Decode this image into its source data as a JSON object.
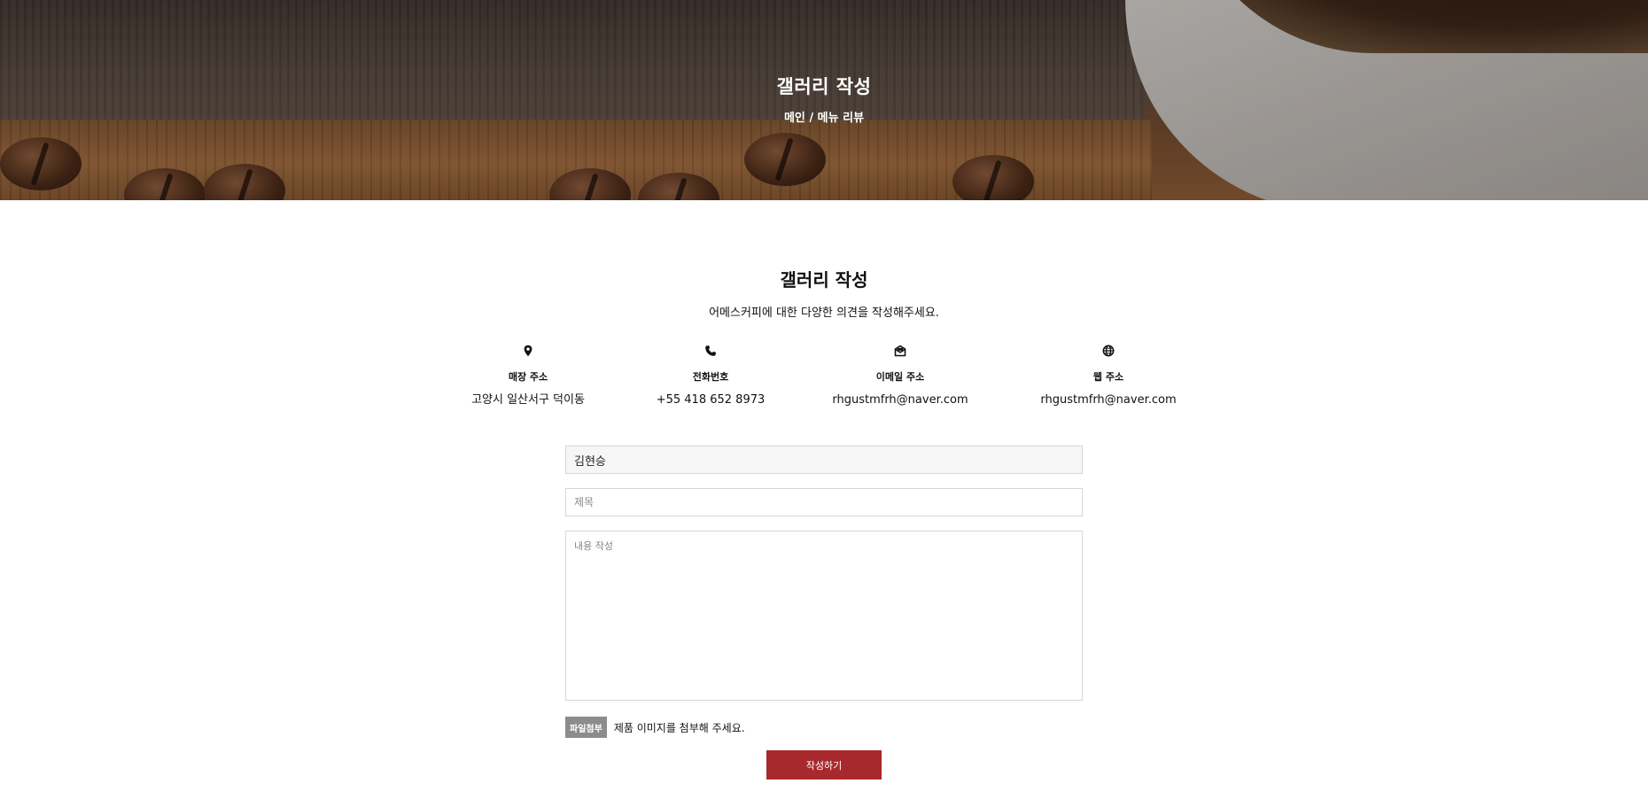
{
  "hero": {
    "title": "갤러리 작성",
    "breadcrumb": "메인 / 메뉴 리뷰"
  },
  "section": {
    "title": "갤러리 작성",
    "subtitle": "어메스커피에 대한 다양한 의견을 작성해주세요."
  },
  "info": [
    {
      "icon": "map-pin-icon",
      "label": "매장 주소",
      "value": "고양시 일산서구 덕이동"
    },
    {
      "icon": "phone-icon",
      "label": "전화번호",
      "value": "+55 418 652 8973"
    },
    {
      "icon": "mail-icon",
      "label": "이메일 주소",
      "value": "rhgustmfrh@naver.com"
    },
    {
      "icon": "globe-icon",
      "label": "웹 주소",
      "value": "rhgustmfrh@naver.com"
    }
  ],
  "form": {
    "name_value": "김현승",
    "title_placeholder": "제목",
    "content_placeholder": "내용 작성",
    "file_button": "파일첨부",
    "file_hint": "제품 이미지를 첨부해 주세요.",
    "submit_label": "작성하기"
  },
  "colors": {
    "accent": "#a8292d",
    "file_button": "#8c8c8c"
  }
}
